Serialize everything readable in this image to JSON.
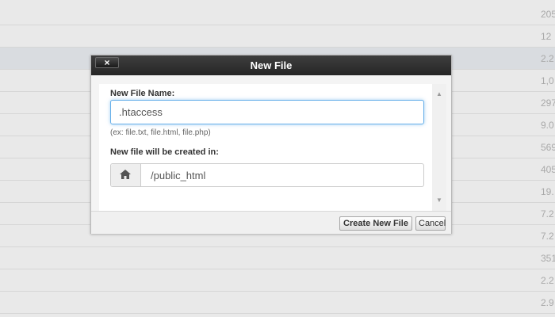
{
  "background_list": {
    "sizes": [
      "205",
      "12",
      "2.2",
      "1,0",
      "297",
      "9.0",
      "569",
      "405",
      "19.",
      "7.2",
      "7.2",
      "351",
      "2.2",
      "2.9"
    ]
  },
  "dialog": {
    "title": "New File",
    "close_label": "×",
    "file_name_label": "New File Name:",
    "file_name_value": ".htaccess",
    "file_name_hint": "(ex: file.txt, file.html, file.php)",
    "location_label": "New file will be created in:",
    "location_value": "/public_html",
    "location_icon": "home-icon",
    "create_button": "Create New File",
    "cancel_button": "Cancel"
  },
  "colors": {
    "titlebar": "#262626",
    "focus_border": "#66afe9",
    "highlight_row": "#d9dce0"
  }
}
